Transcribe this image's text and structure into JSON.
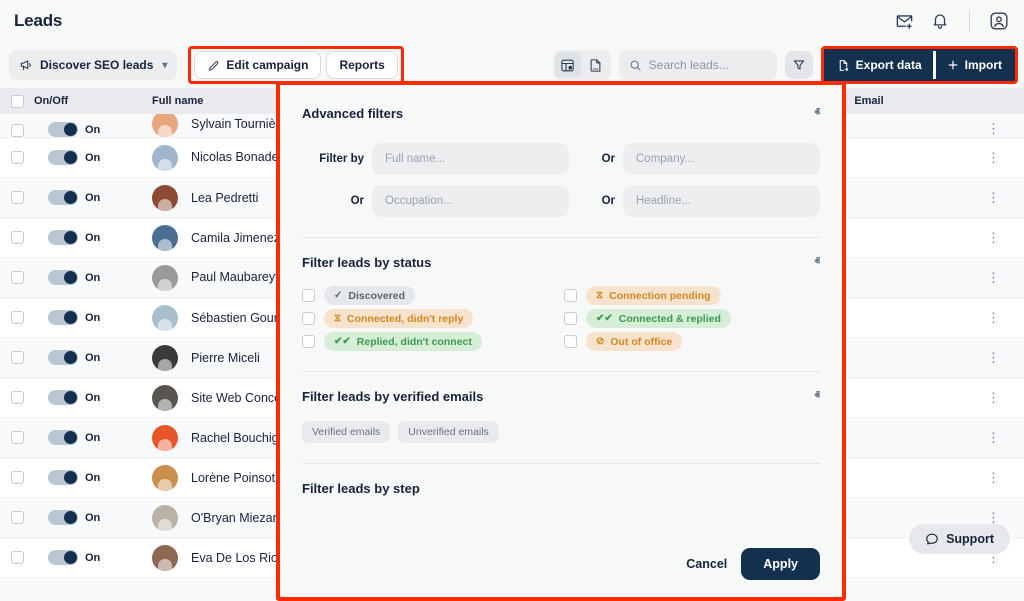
{
  "header": {
    "title": "Leads",
    "icons": [
      {
        "name": "mail-add-icon"
      },
      {
        "name": "bell-icon"
      },
      {
        "name": "account-circle-icon"
      }
    ]
  },
  "toolbar": {
    "campaign_name": "Discover SEO leads",
    "edit_campaign_label": "Edit campaign",
    "reports_label": "Reports",
    "search_placeholder": "Search leads...",
    "search_value": "",
    "export_label": "Export data",
    "import_label": "Import",
    "view_grid_icon": "table-settings-icon",
    "view_csv_icon": "csv-file-icon",
    "filter_icon": "funnel-icon"
  },
  "table": {
    "columns": [
      "On/Off",
      "Full name",
      "Email"
    ],
    "rows": [
      {
        "name": "Sylvain Tournière 😊",
        "toggle": "On",
        "clipped": true
      },
      {
        "name": "Nicolas Bonadei 🎥",
        "toggle": "On"
      },
      {
        "name": "Lea Pedretti",
        "toggle": "On"
      },
      {
        "name": "Camila Jimenez",
        "toggle": "On"
      },
      {
        "name": "Paul Maubareyt 🎯",
        "toggle": "On"
      },
      {
        "name": "Sébastien Gourdon",
        "toggle": "On"
      },
      {
        "name": "Pierre Miceli",
        "toggle": "On"
      },
      {
        "name": "Site Web Conception",
        "toggle": "On"
      },
      {
        "name": "Rachel Bouchigha",
        "toggle": "On"
      },
      {
        "name": "Lorène Poinsot D'addario",
        "toggle": "On"
      },
      {
        "name": "O'Bryan Miezan",
        "toggle": "On"
      },
      {
        "name": "Eva De Los Rios",
        "toggle": "On"
      }
    ],
    "avatar_colors": [
      "#e7a67e",
      "#9fb6cc",
      "#8d4b33",
      "#4a6f93",
      "#9a9a9a",
      "#a8bfcd",
      "#3c3a38",
      "#585450",
      "#e8552a",
      "#c98f4d",
      "#b9b2a6",
      "#8d6852"
    ],
    "kebab_icon": "more-vertical-icon"
  },
  "modal": {
    "advanced": {
      "title": "Advanced filters",
      "caret": "ⱏ",
      "rows": [
        {
          "label": "Filter by",
          "placeholder": "Full name...",
          "value": ""
        },
        {
          "label": "Or",
          "placeholder": "Company...",
          "value": ""
        },
        {
          "label": "Or",
          "placeholder": "Occupation...",
          "value": ""
        },
        {
          "label": "Or",
          "placeholder": "Headline...",
          "value": ""
        }
      ]
    },
    "status": {
      "title": "Filter leads by status",
      "caret": "ⱏ",
      "options": [
        {
          "label": "Discovered",
          "icon": "check-icon",
          "glyph": "✓",
          "style": "b-gray",
          "checked": false
        },
        {
          "label": "Connection pending",
          "icon": "hourglass-icon",
          "glyph": "⧖",
          "style": "b-orange",
          "checked": false
        },
        {
          "label": "Connected, didn't reply",
          "icon": "hourglass-icon",
          "glyph": "⧖",
          "style": "b-orange",
          "checked": false
        },
        {
          "label": "Connected & replied",
          "icon": "double-check-icon",
          "glyph": "✔✔",
          "style": "b-green",
          "checked": false
        },
        {
          "label": "Replied, didn't connect",
          "icon": "double-check-icon",
          "glyph": "✔✔",
          "style": "b-green",
          "checked": false
        },
        {
          "label": "Out of office",
          "icon": "no-entry-icon",
          "glyph": "⊘",
          "style": "b-orange",
          "checked": false
        }
      ]
    },
    "verified": {
      "title": "Filter leads by verified emails",
      "caret": "ⱏ",
      "chips": [
        "Verified emails",
        "Unverified emails"
      ]
    },
    "step": {
      "title": "Filter leads by step",
      "caret": "ⱟ"
    },
    "footer": {
      "cancel_label": "Cancel",
      "apply_label": "Apply"
    }
  },
  "support": {
    "label": "Support",
    "icon": "chat-bubble-icon"
  },
  "colors": {
    "accent_dark": "#14304f",
    "highlight": "#ff2a00",
    "badge_orange": "#d3871f",
    "badge_green": "#3d9a4e",
    "badge_gray": "#5a6574"
  }
}
